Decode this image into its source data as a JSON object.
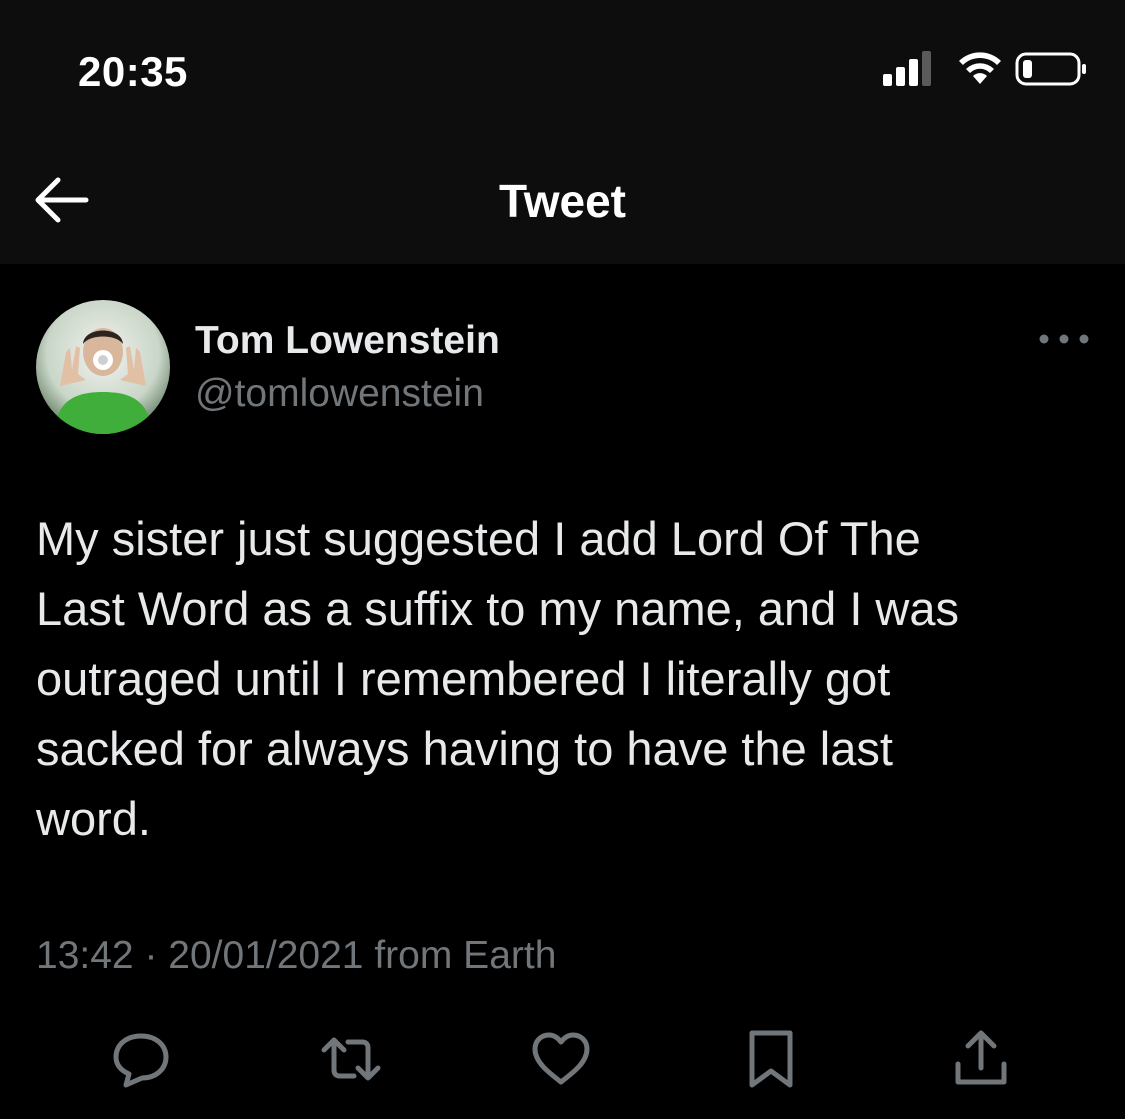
{
  "status_bar": {
    "time": "20:35",
    "icons": [
      "signal-icon",
      "wifi-icon",
      "battery-icon"
    ]
  },
  "nav": {
    "title": "Tweet",
    "back_icon": "arrow-left-icon"
  },
  "tweet": {
    "author": {
      "display_name": "Tom Lowenstein",
      "handle": "@tomlowenstein",
      "avatar": "avatar-photo"
    },
    "more_icon": "ellipsis-icon",
    "text": "My sister just suggested I add Lord Of The\nLast Word as a suffix to my name, and I was\noutraged until I remembered I literally got\nsacked for always having to have the last\nword.",
    "time": "13:42",
    "separator": "·",
    "date": "20/01/2021",
    "source": "from Earth",
    "actions": [
      "reply-icon",
      "retweet-icon",
      "like-icon",
      "bookmark-icon",
      "share-icon"
    ]
  },
  "colors": {
    "background": "#000000",
    "header_background": "#0d0d0d",
    "primary_text": "#e7e9ea",
    "secondary_text": "#71767b"
  }
}
